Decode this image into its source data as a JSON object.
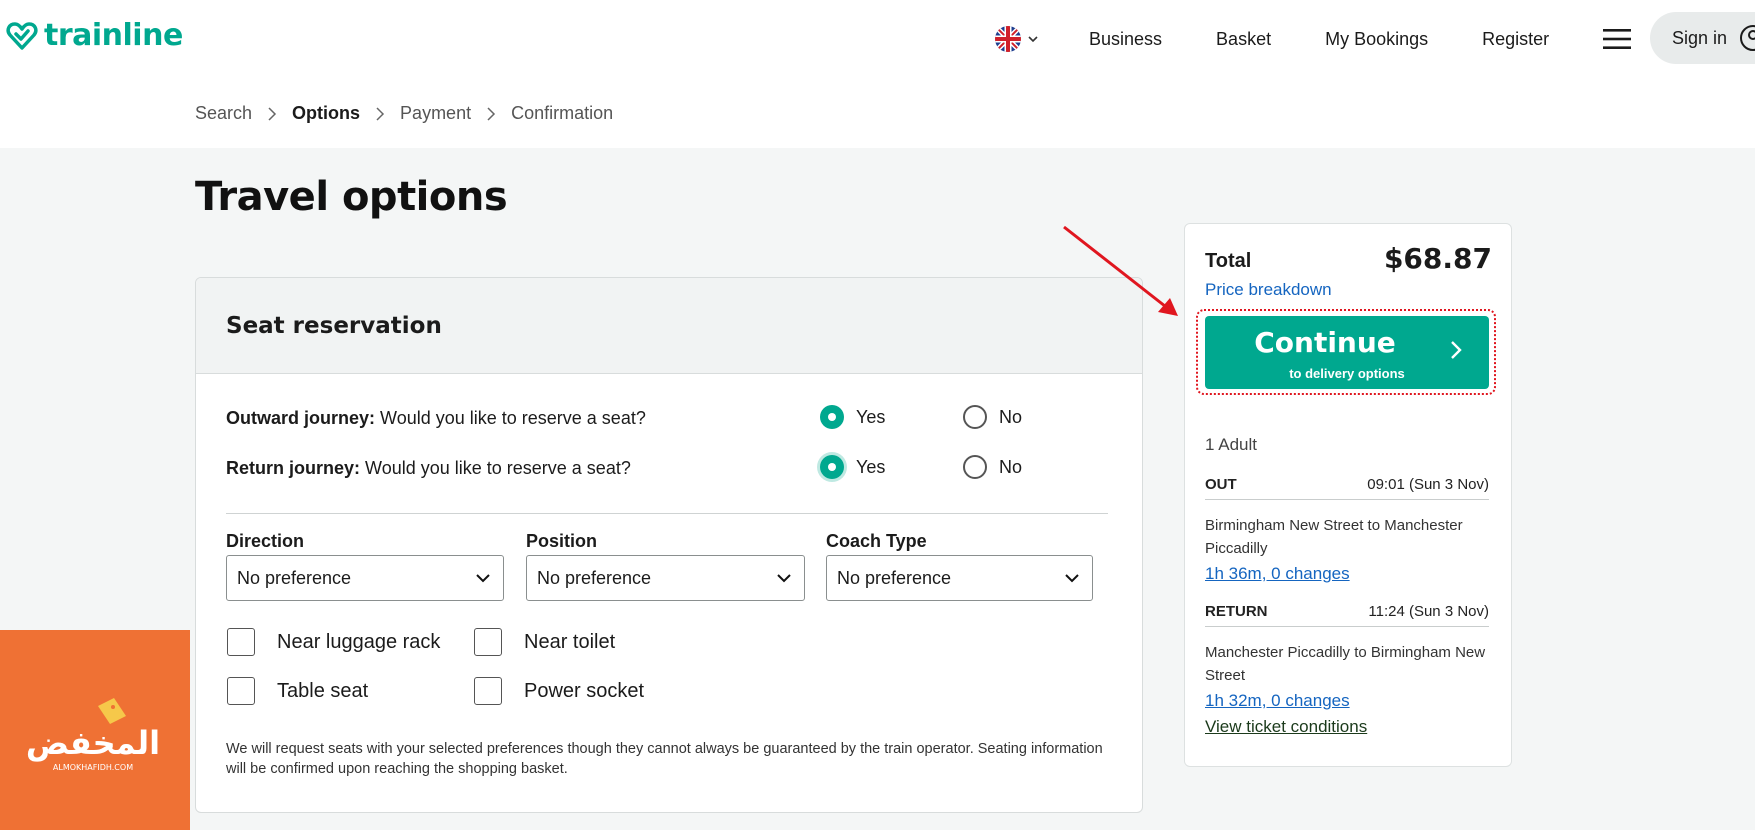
{
  "header": {
    "logo_text": "trainline",
    "nav": [
      "Business",
      "Basket",
      "My Bookings",
      "Register"
    ],
    "signin_label": "Sign in",
    "brand_color": "#00a88f"
  },
  "breadcrumb": {
    "items": [
      "Search",
      "Options",
      "Payment",
      "Confirmation"
    ],
    "active_index": 1
  },
  "page": {
    "title": "Travel options"
  },
  "seat_reservation": {
    "title": "Seat reservation",
    "outward": {
      "label": "Outward journey:",
      "question": "Would you like to reserve a seat?",
      "selected": "Yes"
    },
    "return": {
      "label": "Return journey:",
      "question": "Would you like to reserve a seat?",
      "selected": "Yes"
    },
    "options": {
      "yes": "Yes",
      "no": "No"
    },
    "selects": [
      {
        "label": "Direction",
        "value": "No preference"
      },
      {
        "label": "Position",
        "value": "No preference"
      },
      {
        "label": "Coach Type",
        "value": "No preference"
      }
    ],
    "checkboxes": [
      "Near luggage rack",
      "Near toilet",
      "Table seat",
      "Power socket"
    ],
    "note": "We will request seats with your selected preferences though they cannot always be guaranteed by the train operator. Seating information will be confirmed upon reaching the shopping basket."
  },
  "summary": {
    "total_label": "Total",
    "total_value": "$68.87",
    "price_breakdown": "Price breakdown",
    "continue_main": "Continue",
    "continue_sub": "to delivery options",
    "passengers": "1 Adult",
    "out": {
      "label": "OUT",
      "time": "09:01 (Sun 3 Nov)",
      "route": "Birmingham New Street to Manchester Piccadilly",
      "duration": "1h 36m, 0 changes"
    },
    "ret": {
      "label": "RETURN",
      "time": "11:24 (Sun 3 Nov)",
      "route": "Manchester Piccadilly to Birmingham New Street",
      "duration": "1h 32m, 0 changes"
    },
    "ticket_conditions": "View ticket conditions"
  },
  "watermark": {
    "text": "المخفض",
    "subtext": "ALMOKHAFIDH.COM",
    "color": "#ef7134"
  },
  "annotation": {
    "arrow_color": "#e0161f",
    "highlight": "continue-button"
  }
}
